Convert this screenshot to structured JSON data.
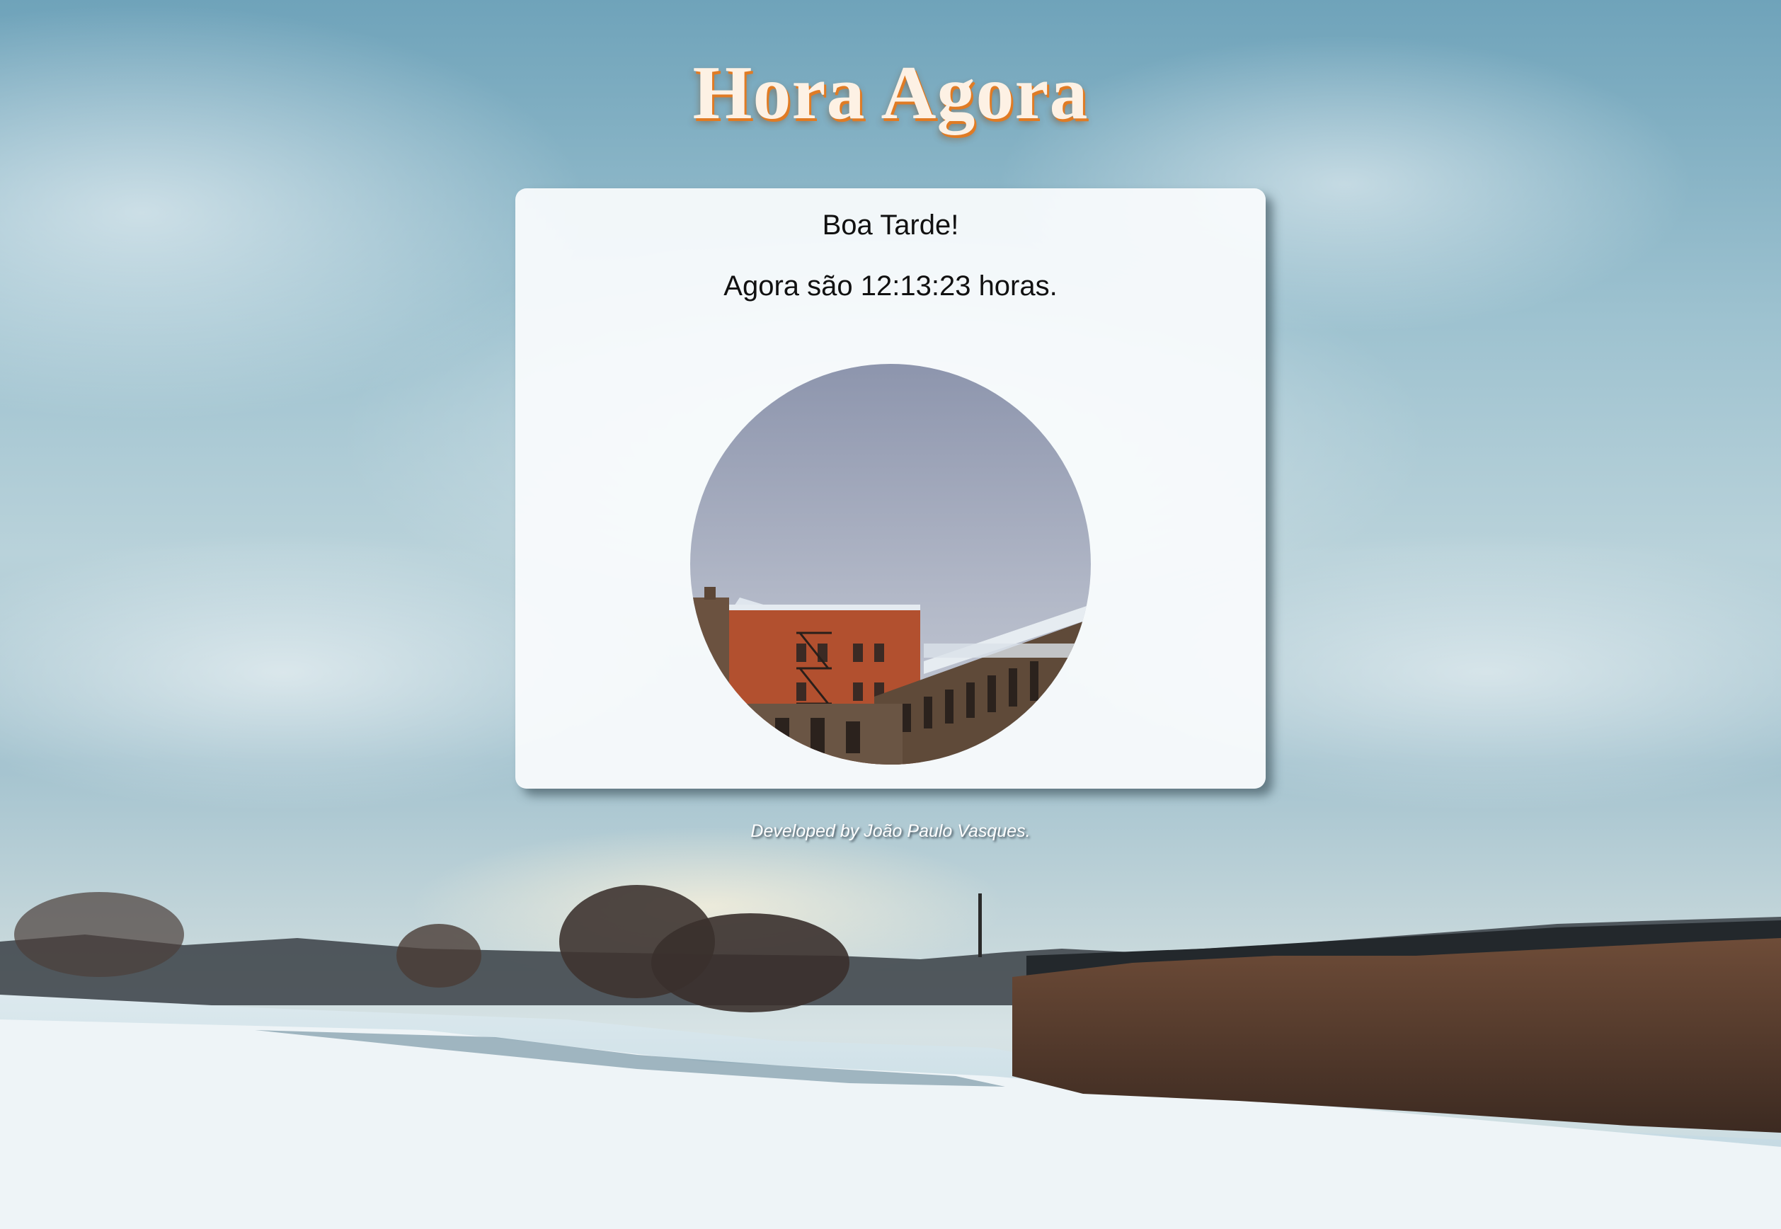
{
  "page": {
    "title": "Hora Agora",
    "greeting": "Boa Tarde!",
    "clock": {
      "prefix": "Agora são",
      "time": "12:13:23",
      "suffix": "horas."
    },
    "footer": "Developed by João Paulo Vasques."
  },
  "colors": {
    "title_text": "#fdf1e4",
    "title_shadow": "#e07b24",
    "card_background": "#fafcfd"
  },
  "images": {
    "background": "snowy-river-landscape-with-cloudy-sky",
    "period_photo": "red-brick-building-with-snowy-rooftop-in-circle"
  }
}
